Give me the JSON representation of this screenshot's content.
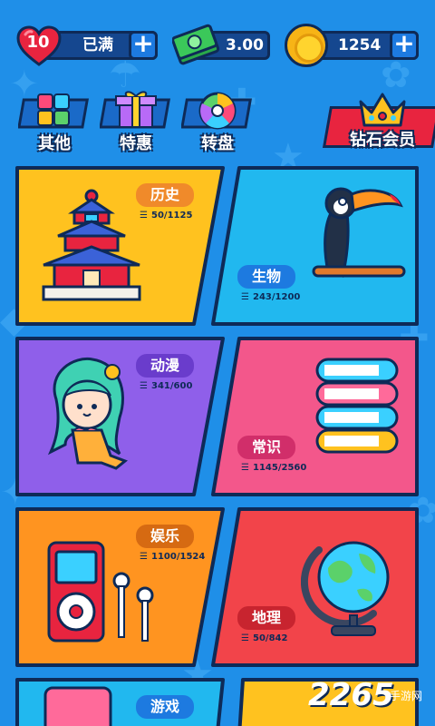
{
  "status": {
    "lives": "10",
    "lives_status": "已满",
    "cash": "3.00",
    "coins": "1254"
  },
  "menu": {
    "other": "其他",
    "deals": "特惠",
    "wheel": "转盘",
    "vip": "钻石会员"
  },
  "categories": [
    {
      "name": "历史",
      "progress": "50/1125"
    },
    {
      "name": "生物",
      "progress": "243/1200"
    },
    {
      "name": "动漫",
      "progress": "341/600"
    },
    {
      "name": "常识",
      "progress": "1145/2560"
    },
    {
      "name": "娱乐",
      "progress": "1100/1524"
    },
    {
      "name": "地理",
      "progress": "50/842"
    },
    {
      "name": "游戏",
      "progress": ""
    }
  ],
  "watermark": {
    "logo": "2265",
    "sub": "手游网"
  },
  "colors": {
    "background": "#1f8fe8",
    "outline": "#0e2a57",
    "history": "#ffc21f",
    "biology": "#21b8ef",
    "anime": "#8f5fea",
    "knowledge": "#f3578b",
    "entertainment": "#ff9420",
    "geography": "#f2444a"
  }
}
